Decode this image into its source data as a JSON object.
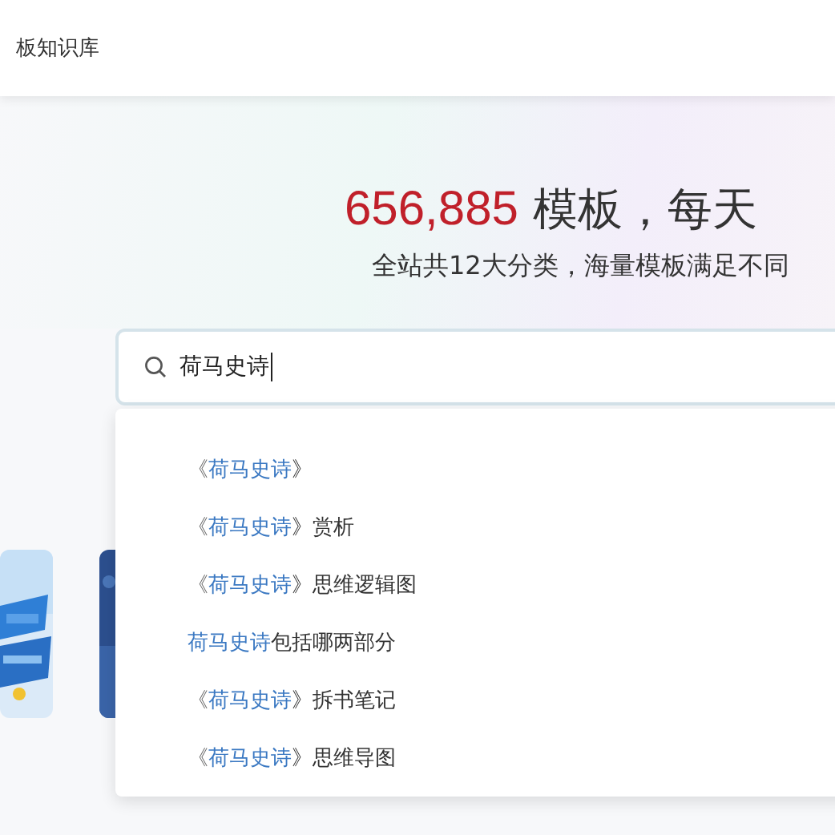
{
  "header": {
    "title": "板知识库"
  },
  "hero": {
    "count": "656,885",
    "headline": " 模板，每天",
    "subtitle": "全站共12大分类，海量模板满足不同"
  },
  "search": {
    "value": "荷马史诗"
  },
  "suggestions": [
    {
      "prefix": "《",
      "match": "荷马史诗",
      "suffix": "》"
    },
    {
      "prefix": "《",
      "match": "荷马史诗",
      "suffix": "》赏析"
    },
    {
      "prefix": "《",
      "match": "荷马史诗",
      "suffix": "》思维逻辑图"
    },
    {
      "match": "荷马史诗",
      "suffix": "包括哪两部分"
    },
    {
      "prefix": "《",
      "match": "荷马史诗",
      "suffix": "》拆书笔记"
    },
    {
      "prefix": "《",
      "match": "荷马史诗",
      "suffix": "》思维导图"
    }
  ]
}
